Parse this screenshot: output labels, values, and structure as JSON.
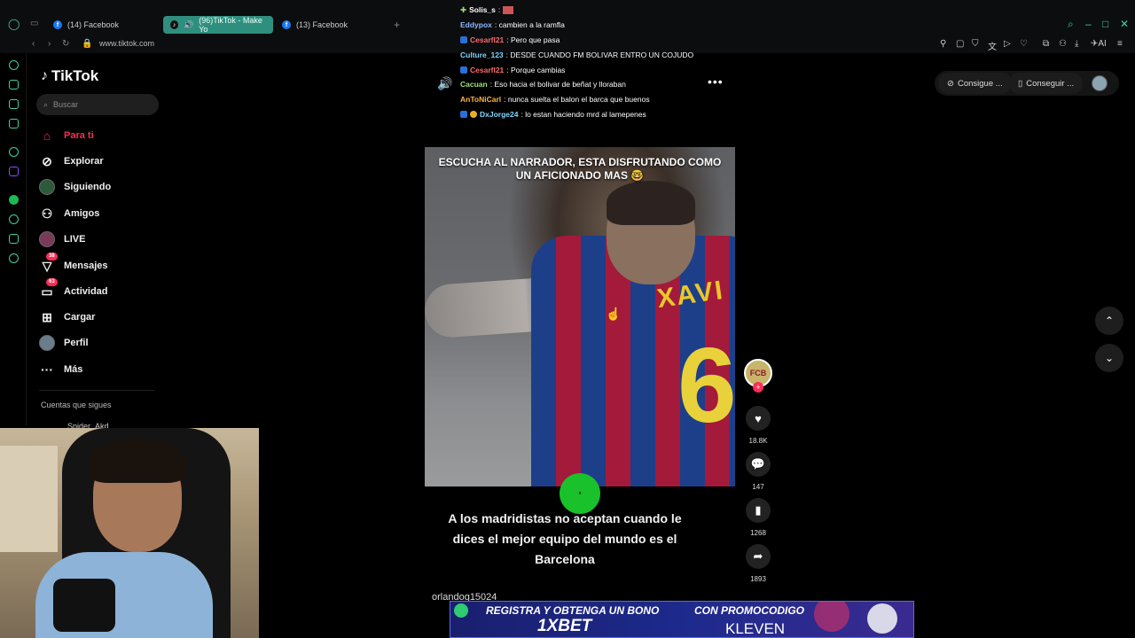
{
  "browser": {
    "tabs": [
      {
        "label": "(14) Facebook",
        "active": false
      },
      {
        "label": "(96)TikTok - Make Yo",
        "active": true
      },
      {
        "label": "(13) Facebook",
        "active": false
      }
    ],
    "url": "www.tiktok.com"
  },
  "sidebar": {
    "logo": "TikTok",
    "search_placeholder": "Buscar",
    "items": [
      {
        "label": "Para ti",
        "icon": "home-icon",
        "active": true
      },
      {
        "label": "Explorar",
        "icon": "compass-icon"
      },
      {
        "label": "Siguiendo",
        "icon": "following-avatar"
      },
      {
        "label": "Amigos",
        "icon": "friends-icon"
      },
      {
        "label": "LIVE",
        "icon": "live-icon"
      },
      {
        "label": "Mensajes",
        "icon": "messages-icon",
        "badge": "38"
      },
      {
        "label": "Actividad",
        "icon": "activity-icon",
        "badge": "63"
      },
      {
        "label": "Cargar",
        "icon": "upload-icon"
      },
      {
        "label": "Perfil",
        "icon": "profile-avatar"
      },
      {
        "label": "Más",
        "icon": "more-icon"
      }
    ],
    "follows_title": "Cuentas que sigues",
    "follows_first": "Spider_Akd"
  },
  "chat": [
    {
      "user": "Solis_s",
      "msg": "",
      "color": "#ffffff"
    },
    {
      "user": "Eddypox",
      "msg": ": cambien a la ramfla",
      "color": "#8fb7ff"
    },
    {
      "user": "Cesarfl21",
      "msg": ": Pero que pasa",
      "color": "#ff6b6b"
    },
    {
      "user": "Culture_123",
      "msg": ": DESDE CUANDO FM BOLIVAR ENTRO UN COJUDO",
      "color": "#7fd8ff"
    },
    {
      "user": "Cesarfl21",
      "msg": ": Porque cambias",
      "color": "#ff6b6b"
    },
    {
      "user": "Cacuan",
      "msg": ": Eso hacia el bolivar de beñat y lloraban",
      "color": "#9be37a"
    },
    {
      "user": "AnToNiCarl",
      "msg": ": nunca suelta el balon el barca que buenos",
      "color": "#ffb347"
    },
    {
      "user": "DxJorge24",
      "msg": ": lo estan haciendo mrd al lamepenes",
      "color": "#7fd8ff"
    }
  ],
  "video": {
    "caption": "ESCUCHA AL NARRADOR, ESTA DISFRUTANDO COMO UN AFICIONADO MAS 🤓",
    "jersey_name": "XAVI",
    "jersey_number": "6",
    "description": "A los madridistas no aceptan cuando le dices el mejor equipo del mundo es el Barcelona",
    "author": "orlandog15024"
  },
  "actions": {
    "likes": "18.8K",
    "comments": "147",
    "saves": "1268",
    "shares": "1893"
  },
  "topright": {
    "pill1": "Consigue ...",
    "pill2": "Conseguir ..."
  },
  "ad": {
    "left": "REGISTRA Y OBTENGA UN BONO",
    "brand": "1XBET",
    "right": "CON PROMOCODIGO",
    "code": "KLEVEN"
  },
  "colors": {
    "accent": "#fe2c55",
    "browser_accent": "#3fd0a5"
  }
}
